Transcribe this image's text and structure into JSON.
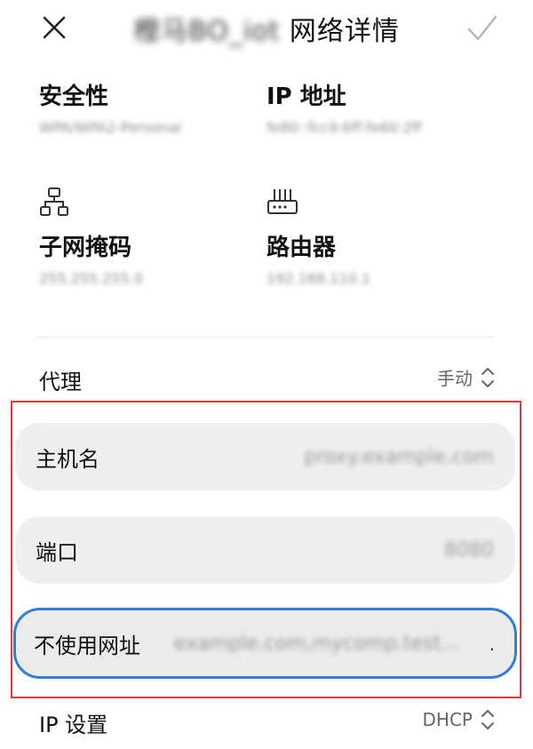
{
  "header": {
    "ssid": "橙马BO_iot",
    "title_suffix": "网络详情"
  },
  "info": {
    "security_label": "安全性",
    "security_value": "WPA/WPA2-Personal",
    "ip_label": "IP 地址",
    "ip_value": "fe80::fcc9:6ff:fe60:2ff",
    "subnet_label": "子网掩码",
    "subnet_value": "255.255.255.0",
    "router_label": "路由器",
    "router_value": "192.168.110.1"
  },
  "proxy": {
    "label": "代理",
    "value": "手动",
    "host_label": "主机名",
    "host_value": "proxy.example.com",
    "port_label": "端口",
    "port_value": "8080",
    "bypass_label": "不使用网址",
    "bypass_value": "example.com,mycomp.test..."
  },
  "ip_settings": {
    "label": "IP 设置",
    "value": "DHCP"
  },
  "icons": {
    "close": "close-icon",
    "confirm": "check-icon",
    "subnet": "network-topology-icon",
    "router": "router-icon",
    "selector": "chevron-updown-icon"
  },
  "colors": {
    "focus_border": "#2f7fd9",
    "highlight_box": "#e23b3b",
    "field_bg": "#efefef"
  }
}
